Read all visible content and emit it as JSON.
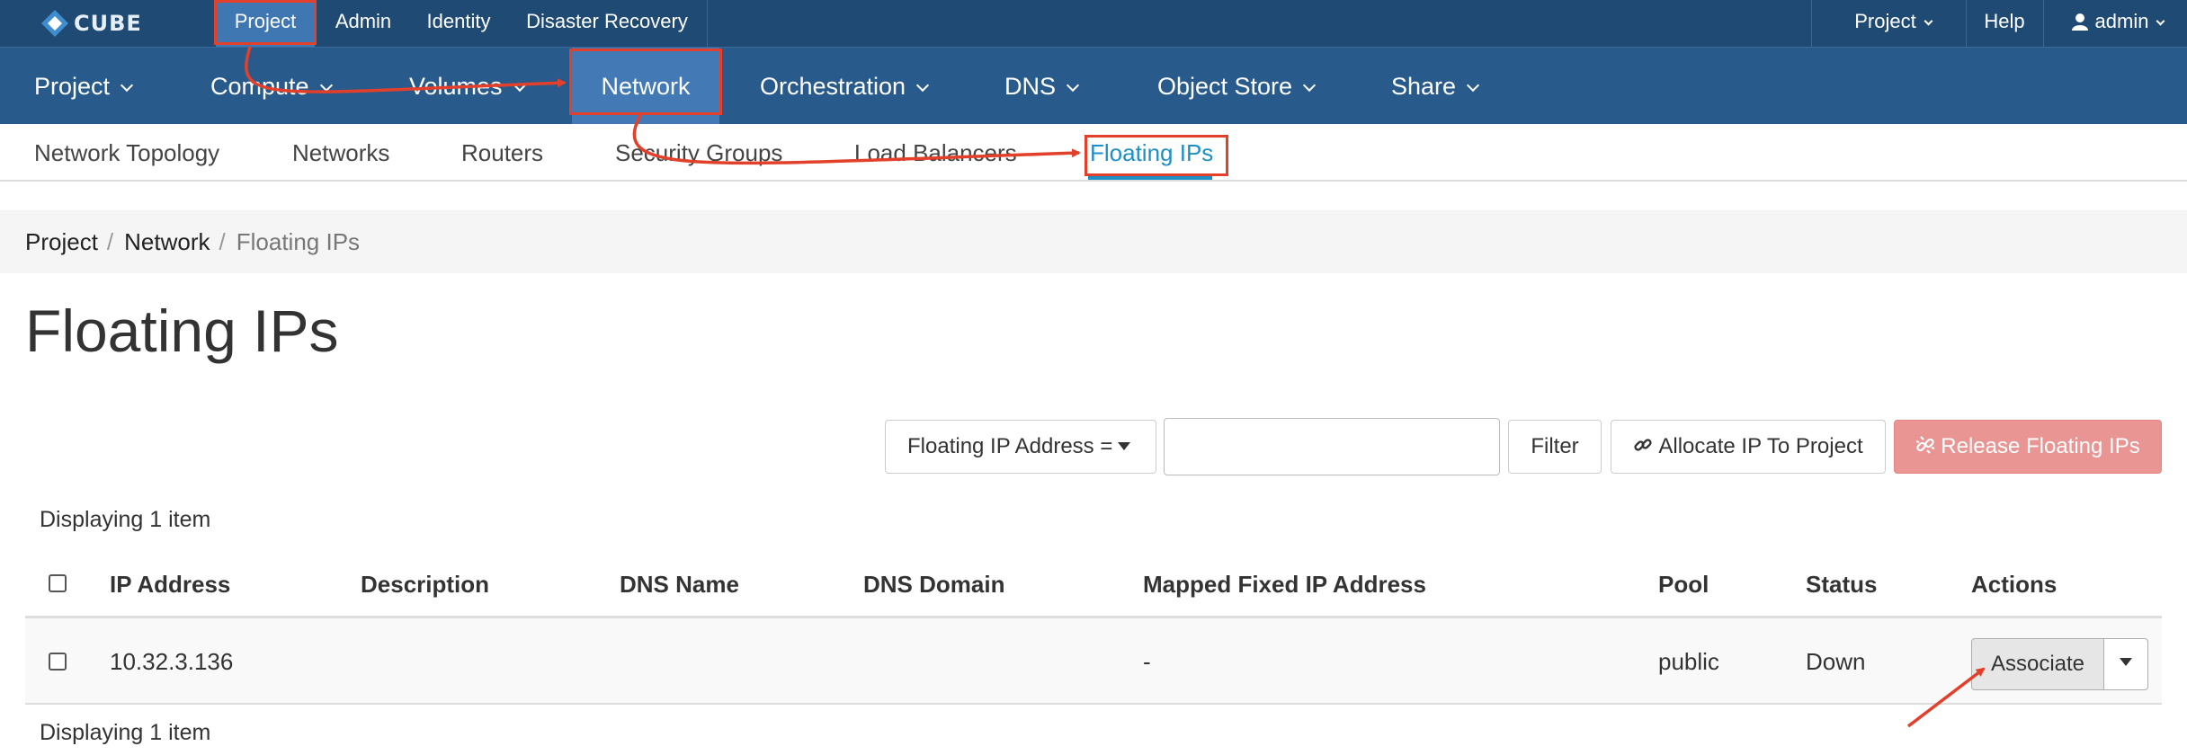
{
  "brand": {
    "name": "CUBE"
  },
  "topbar": {
    "items": [
      "Project",
      "Admin",
      "Identity",
      "Disaster Recovery"
    ],
    "right": {
      "project": "Project",
      "help": "Help",
      "user": "admin"
    }
  },
  "mainnav": {
    "items": [
      "Project",
      "Compute",
      "Volumes",
      "Network",
      "Orchestration",
      "DNS",
      "Object Store",
      "Share"
    ]
  },
  "subnav": {
    "items": [
      "Network Topology",
      "Networks",
      "Routers",
      "Security Groups",
      "Load Balancers",
      "Floating IPs"
    ]
  },
  "breadcrumb": {
    "items": [
      "Project",
      "Network",
      "Floating IPs"
    ]
  },
  "page": {
    "title": "Floating IPs"
  },
  "toolbar": {
    "filter_field": "Floating IP Address =",
    "filter_value": "",
    "filter_button": "Filter",
    "allocate_button": "Allocate IP To Project",
    "release_button": "Release Floating IPs"
  },
  "table": {
    "count_label": "Displaying 1 item",
    "columns": [
      "IP Address",
      "Description",
      "DNS Name",
      "DNS Domain",
      "Mapped Fixed IP Address",
      "Pool",
      "Status",
      "Actions"
    ],
    "rows": [
      {
        "ip": "10.32.3.136",
        "description": "",
        "dns_name": "",
        "dns_domain": "",
        "mapped_fixed_ip": "-",
        "pool": "public",
        "status": "Down",
        "action": "Associate"
      }
    ]
  },
  "colors": {
    "topbar": "#1f4a73",
    "mainnav": "#285b8c",
    "active_tab": "#4379b4",
    "link_active": "#1e8fc6",
    "danger": "#e99594",
    "annotation": "#e2402b"
  }
}
